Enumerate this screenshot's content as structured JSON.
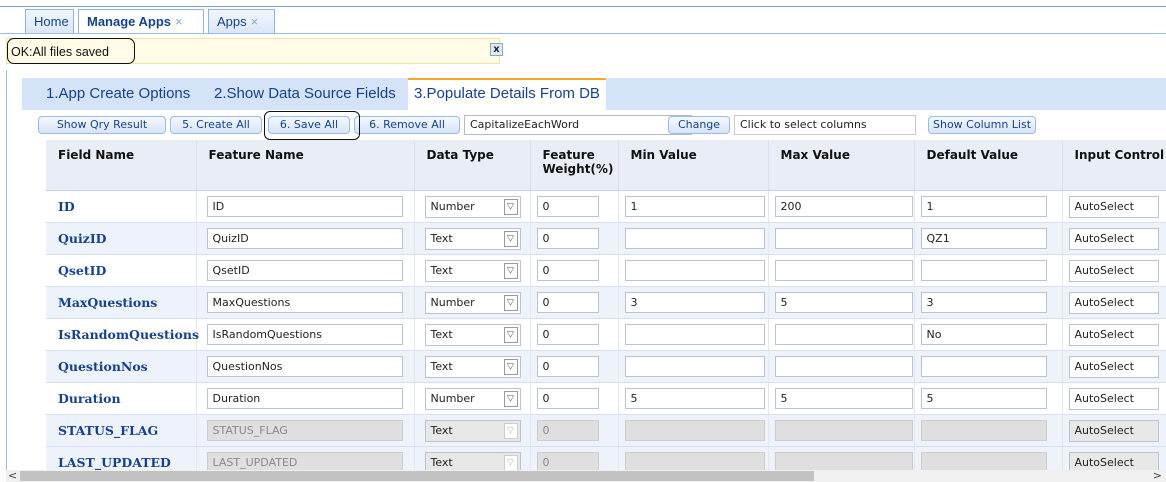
{
  "tabs": [
    {
      "label": "Home",
      "closable": false
    },
    {
      "label": "Manage Apps",
      "closable": true
    },
    {
      "label": "Apps",
      "closable": true
    }
  ],
  "close_glyph": "×",
  "status": {
    "message": "OK:All files saved",
    "close_label": "x"
  },
  "wizard_tabs": [
    "1.App Create Options",
    "2.Show Data Source Fields",
    "3.Populate Details From DB"
  ],
  "toolbar": {
    "show_qry": "Show Qry Result",
    "create_all": "5. Create All",
    "save_all": "6. Save All",
    "remove_all": "6. Remove All",
    "case_value": "CapitalizeEachWord",
    "change": "Change",
    "columns_placeholder": "Click to select columns",
    "show_column_list": "Show Column List"
  },
  "grid": {
    "headers": [
      "Field Name",
      "Feature Name",
      "Data Type",
      "Feature Weight(%)",
      "Min Value",
      "Max Value",
      "Default Value",
      "Input Control"
    ],
    "rows": [
      {
        "field": "ID",
        "feature": "ID",
        "type": "Number",
        "weight": "0",
        "min": "1",
        "max": "200",
        "default": "1",
        "control": "AutoSelect",
        "disabled": false
      },
      {
        "field": "QuizID",
        "feature": "QuizID",
        "type": "Text",
        "weight": "0",
        "min": "",
        "max": "",
        "default": "QZ1",
        "control": "AutoSelect",
        "disabled": false
      },
      {
        "field": "QsetID",
        "feature": "QsetID",
        "type": "Text",
        "weight": "0",
        "min": "",
        "max": "",
        "default": "",
        "control": "AutoSelect",
        "disabled": false
      },
      {
        "field": "MaxQuestions",
        "feature": "MaxQuestions",
        "type": "Number",
        "weight": "0",
        "min": "3",
        "max": "5",
        "default": "3",
        "control": "AutoSelect",
        "disabled": false
      },
      {
        "field": "IsRandomQuestions",
        "feature": "IsRandomQuestions",
        "type": "Text",
        "weight": "0",
        "min": "",
        "max": "",
        "default": "No",
        "control": "AutoSelect",
        "disabled": false
      },
      {
        "field": "QuestionNos",
        "feature": "QuestionNos",
        "type": "Text",
        "weight": "0",
        "min": "",
        "max": "",
        "default": "",
        "control": "AutoSelect",
        "disabled": false
      },
      {
        "field": "Duration",
        "feature": "Duration",
        "type": "Number",
        "weight": "0",
        "min": "5",
        "max": "5",
        "default": "5",
        "control": "AutoSelect",
        "disabled": false
      },
      {
        "field": "STATUS_FLAG",
        "feature": "STATUS_FLAG",
        "type": "Text",
        "weight": "0",
        "min": "",
        "max": "",
        "default": "",
        "control": "AutoSelect",
        "disabled": true
      },
      {
        "field": "LAST_UPDATED",
        "feature": "LAST_UPDATED",
        "type": "Text",
        "weight": "0",
        "min": "",
        "max": "",
        "default": "",
        "control": "AutoSelect",
        "disabled": true
      }
    ]
  },
  "scrollbar": {
    "left_arrow": "<",
    "right_arrow": ">"
  },
  "colors": {
    "accent": "#15428b",
    "tab_highlight": "#f6a828",
    "status_bg": "#fffbe6"
  }
}
